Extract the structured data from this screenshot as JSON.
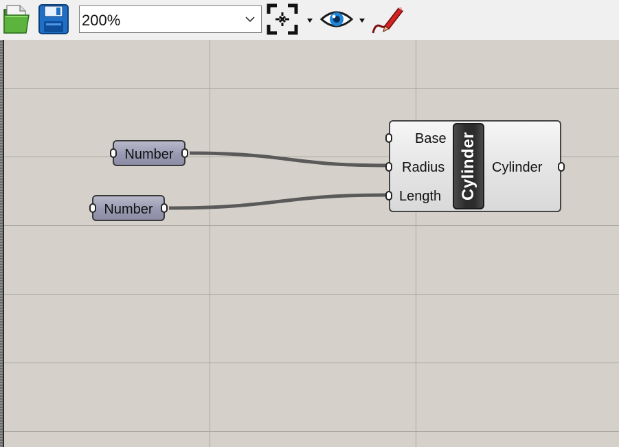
{
  "toolbar": {
    "zoom": {
      "value": "200%"
    },
    "icons": {
      "open": "open-folder-icon",
      "save": "save-disk-icon",
      "zoom_extents": "zoom-extents-icon",
      "preview": "eye-preview-icon",
      "sketch": "sketch-pen-icon"
    }
  },
  "canvas": {
    "params": [
      {
        "label": "Number"
      },
      {
        "label": "Number"
      }
    ],
    "component": {
      "name": "Cylinder",
      "inputs": [
        "Base",
        "Radius",
        "Length"
      ],
      "output": "Cylinder"
    }
  },
  "colors": {
    "canvas_bg": "#d5d1ca",
    "grid_line": "#a9a6a0",
    "wire": "#5a5a5a",
    "param_fill": "#9e9eb5",
    "component_fill": "#e6e6e6",
    "badge_fill": "#2c2c2c"
  }
}
